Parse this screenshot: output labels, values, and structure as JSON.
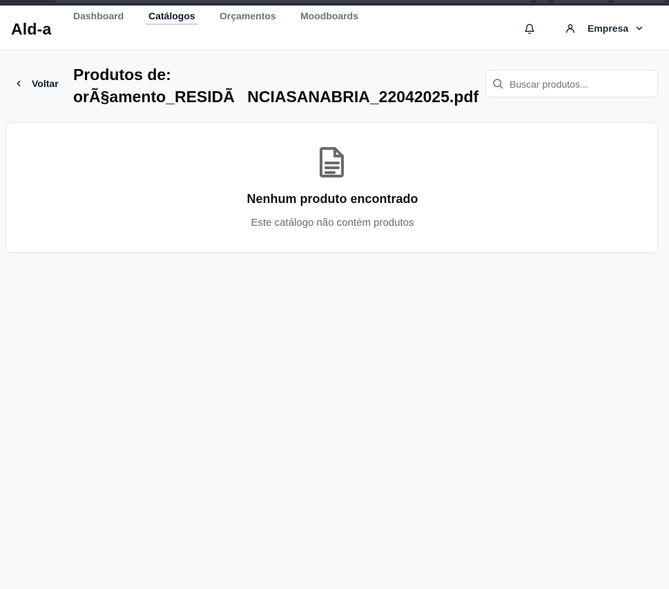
{
  "app": {
    "brand": "Ald-a"
  },
  "nav": {
    "items": [
      {
        "label": "Dashboard",
        "active": false
      },
      {
        "label": "Catálogos",
        "active": true
      },
      {
        "label": "Orçamentos",
        "active": false
      },
      {
        "label": "Moodboards",
        "active": false
      }
    ]
  },
  "header": {
    "notifications_icon": "bell-icon",
    "user_icon": "user-icon",
    "user_label": "Empresa",
    "user_menu_icon": "chevron-down-icon"
  },
  "page": {
    "back_label": "Voltar",
    "back_icon": "chevron-left-icon",
    "title_line1": "Produtos de:",
    "title_line2": "orÃ§amento_RESIDÃNCIASANABRIA_22042025.pdf"
  },
  "search": {
    "placeholder": "Buscar produtos...",
    "value": "",
    "icon": "search-icon"
  },
  "empty_state": {
    "icon": "document-icon",
    "title": "Nenhum produto encontrado",
    "subtitle": "Este catálogo não contém produtos"
  },
  "colors": {
    "page_background": "#f8f9fa",
    "header_background": "#ffffff",
    "card_background": "#ffffff",
    "icon_color": "#6b6b6b"
  }
}
